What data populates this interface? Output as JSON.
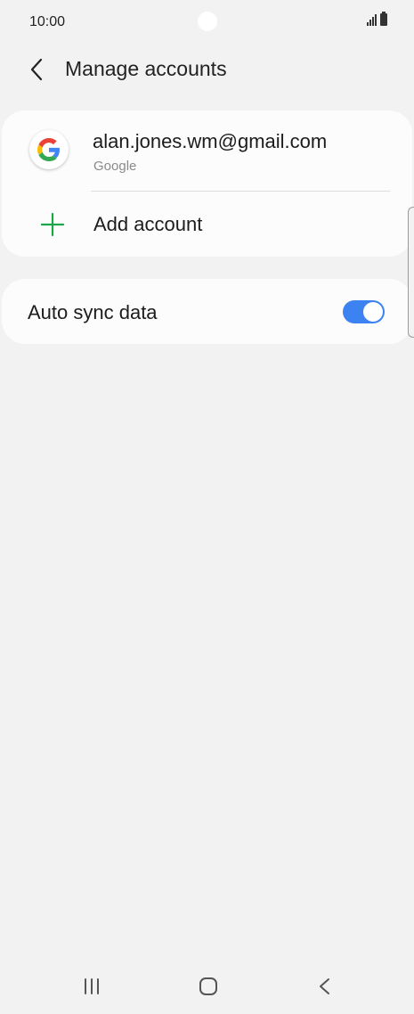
{
  "status_bar": {
    "time": "10:00",
    "icons": [
      "signal-icon",
      "battery-icon"
    ]
  },
  "header": {
    "back_icon": "chevron-left-icon",
    "title": "Manage accounts"
  },
  "accounts": [
    {
      "email": "alan.jones.wm@gmail.com",
      "provider": "Google",
      "icon": "google-logo-icon"
    }
  ],
  "add_account": {
    "label": "Add account",
    "icon": "plus-icon",
    "icon_color": "#1aa74a"
  },
  "auto_sync": {
    "label": "Auto sync data",
    "enabled": true,
    "toggle_color": "#3c82f0"
  },
  "nav_bar": {
    "icons": [
      "recent-apps-icon",
      "home-icon",
      "back-icon"
    ]
  }
}
